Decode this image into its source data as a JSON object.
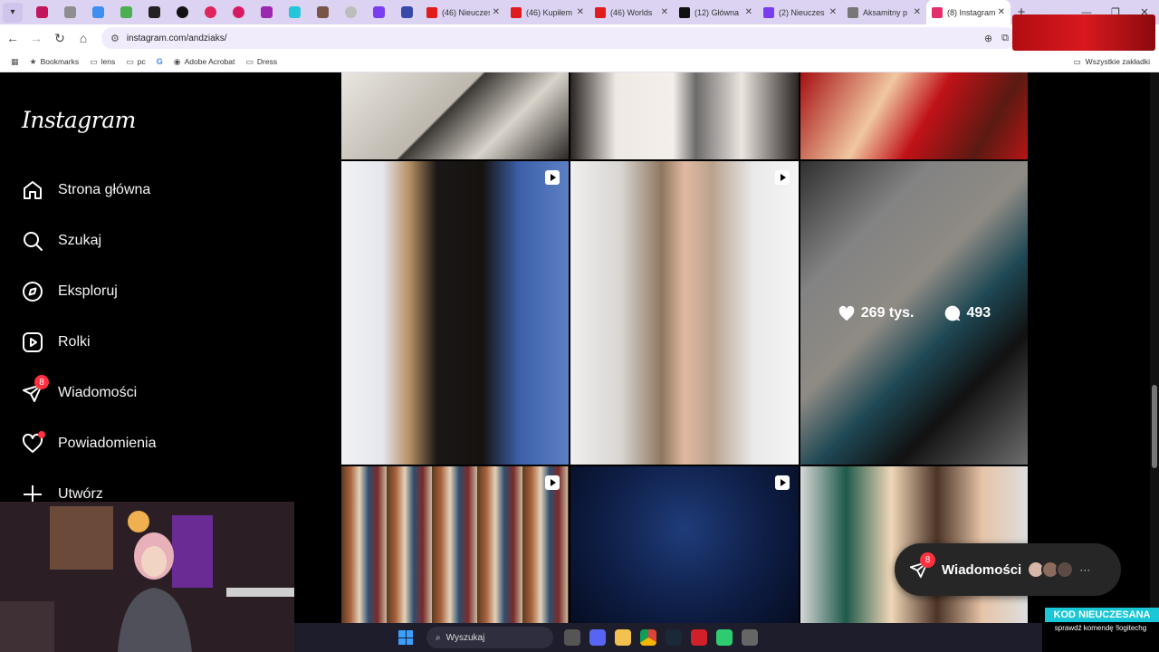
{
  "browser": {
    "tabs": [
      {
        "title": "(46) Nieuczes",
        "color": "#e01c1c"
      },
      {
        "title": "(46) Kupiłem",
        "color": "#e01c1c"
      },
      {
        "title": "(46) Worlds",
        "color": "#e01c1c"
      },
      {
        "title": "(12) Główna",
        "color": "#111111"
      },
      {
        "title": "(2) Nieuczes",
        "color": "#7a3df0"
      },
      {
        "title": "Aksamitny p",
        "color": "#777777"
      },
      {
        "title": "(8) Instagram",
        "color": "#e1306c"
      }
    ],
    "url": "instagram.com/andziaks/",
    "bookmarks": [
      "Bookmarks",
      "lens",
      "pc",
      "Adobe Acrobat",
      "Dress"
    ],
    "all_bookmarks": "Wszystkie zakładki"
  },
  "sidebar": {
    "logo": "Instagram",
    "items": [
      {
        "label": "Strona główna",
        "icon": "home-icon"
      },
      {
        "label": "Szukaj",
        "icon": "search-icon"
      },
      {
        "label": "Eksploruj",
        "icon": "compass-icon"
      },
      {
        "label": "Rolki",
        "icon": "reels-icon"
      },
      {
        "label": "Wiadomości",
        "icon": "messenger-icon",
        "badge": "8"
      },
      {
        "label": "Powiadomienia",
        "icon": "heart-icon"
      },
      {
        "label": "Utwórz",
        "icon": "plus-icon"
      }
    ]
  },
  "posts": {
    "hovered": {
      "likes": "269 tys.",
      "comments": "493"
    }
  },
  "messages": {
    "label": "Wiadomości",
    "badge": "8"
  },
  "promo": {
    "title": "KOD NIEUCZESANA",
    "subtitle": "sprawdź komendę !logitechg"
  },
  "taskbar": {
    "search": "Wyszukaj"
  },
  "colors": {
    "accent_badge": "#ff3040",
    "background": "#000000",
    "text": "#f5f5f5"
  }
}
